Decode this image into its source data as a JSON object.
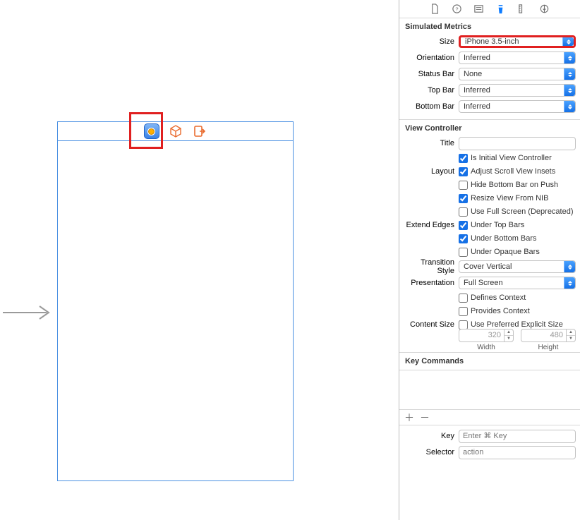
{
  "canvas": {
    "icons": {
      "view_controller": "view-controller-icon",
      "first_responder": "first-responder-cube-icon",
      "exit": "exit-icon"
    }
  },
  "inspector_tabs": {
    "file": "file-icon",
    "help": "help-icon",
    "identity": "identity-icon",
    "attributes": "attributes-icon",
    "size": "ruler-icon",
    "connections": "connections-icon"
  },
  "simulated_metrics": {
    "heading": "Simulated Metrics",
    "size_label": "Size",
    "size_value": "iPhone 3.5-inch",
    "orient_label": "Orientation",
    "orient_value": "Inferred",
    "status_label": "Status Bar",
    "status_value": "None",
    "top_label": "Top Bar",
    "top_value": "Inferred",
    "bottom_label": "Bottom Bar",
    "bottom_value": "Inferred"
  },
  "view_controller": {
    "heading": "View Controller",
    "title_label": "Title",
    "title_value": "",
    "is_initial_label": "Is Initial View Controller",
    "layout_label": "Layout",
    "adj_scroll_label": "Adjust Scroll View Insets",
    "hide_bottom_label": "Hide Bottom Bar on Push",
    "resize_nib_label": "Resize View From NIB",
    "use_full_label": "Use Full Screen (Deprecated)",
    "extend_label": "Extend Edges",
    "under_top_label": "Under Top Bars",
    "under_bottom_label": "Under Bottom Bars",
    "under_opaque_label": "Under Opaque Bars",
    "transition_label": "Transition Style",
    "transition_value": "Cover Vertical",
    "presentation_label": "Presentation",
    "presentation_value": "Full Screen",
    "defines_ctx_label": "Defines Context",
    "provides_ctx_label": "Provides Context",
    "content_size_label": "Content Size",
    "use_pref_label": "Use Preferred Explicit Size",
    "width_value": "320",
    "height_value": "480",
    "width_sub": "Width",
    "height_sub": "Height"
  },
  "key_commands": {
    "heading": "Key Commands",
    "key_label": "Key",
    "key_placeholder": "Enter ⌘ Key",
    "selector_label": "Selector",
    "selector_placeholder": "action"
  }
}
